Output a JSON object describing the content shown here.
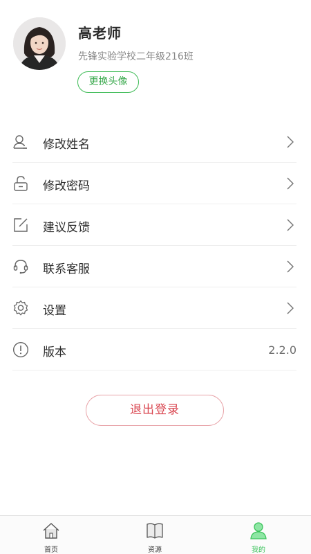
{
  "profile": {
    "name": "高老师",
    "school": "先锋实验学校二年级216班",
    "change_avatar_label": "更换头像"
  },
  "menu": {
    "items": [
      {
        "label": "修改姓名",
        "icon": "user-icon"
      },
      {
        "label": "修改密码",
        "icon": "unlock-icon"
      },
      {
        "label": "建议反馈",
        "icon": "edit-icon"
      },
      {
        "label": "联系客服",
        "icon": "headset-icon"
      },
      {
        "label": "设置",
        "icon": "gear-icon"
      },
      {
        "label": "版本",
        "icon": "info-icon",
        "value": "2.2.0"
      }
    ]
  },
  "logout_label": "退出登录",
  "tabbar": {
    "tabs": [
      {
        "label": "首页",
        "icon": "home-icon"
      },
      {
        "label": "资源",
        "icon": "book-icon"
      },
      {
        "label": "我的",
        "icon": "person-icon",
        "active": true
      }
    ]
  },
  "colors": {
    "accent_green": "#3cc35c",
    "logout_red": "#d9454f",
    "divider": "#eeeeee"
  }
}
